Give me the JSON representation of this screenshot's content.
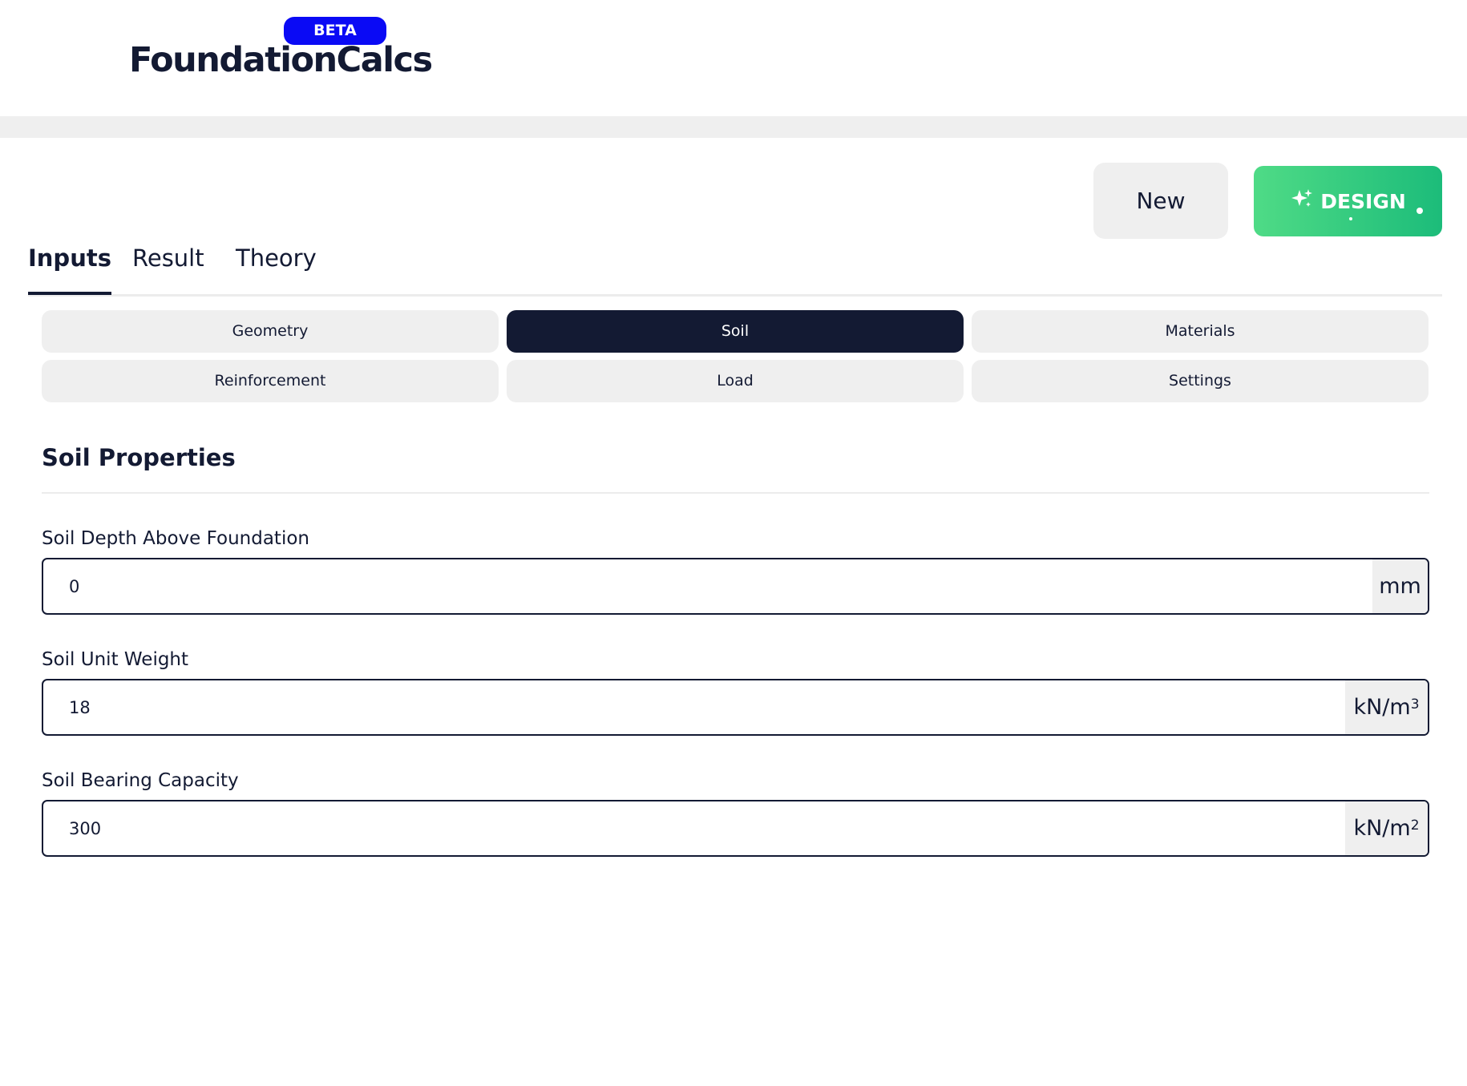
{
  "app": {
    "logo_text": "FoundationCalcs",
    "beta_badge": "BETA"
  },
  "actions": {
    "new_label": "New",
    "design_label": "DESIGN",
    "design_icon": "sparkles-icon"
  },
  "tabs": [
    {
      "label": "Inputs",
      "active": true
    },
    {
      "label": "Result",
      "active": false
    },
    {
      "label": "Theory",
      "active": false
    }
  ],
  "subtabs": [
    {
      "label": "Geometry",
      "active": false
    },
    {
      "label": "Soil",
      "active": true
    },
    {
      "label": "Materials",
      "active": false
    },
    {
      "label": "Reinforcement",
      "active": false
    },
    {
      "label": "Load",
      "active": false
    },
    {
      "label": "Settings",
      "active": false
    }
  ],
  "section": {
    "title": "Soil Properties"
  },
  "fields": [
    {
      "label": "Soil Depth Above Foundation",
      "value": "0",
      "unit": "mm",
      "unit_sup": ""
    },
    {
      "label": "Soil Unit Weight",
      "value": "18",
      "unit": "kN/m",
      "unit_sup": "3"
    },
    {
      "label": "Soil Bearing Capacity",
      "value": "300",
      "unit": "kN/m",
      "unit_sup": "2"
    }
  ],
  "colors": {
    "brand_dark": "#131a33",
    "beta_blue": "#0a0af5",
    "design_green_start": "#4fdb86",
    "design_green_end": "#1cbc7a",
    "neutral_bg": "#efefef"
  }
}
